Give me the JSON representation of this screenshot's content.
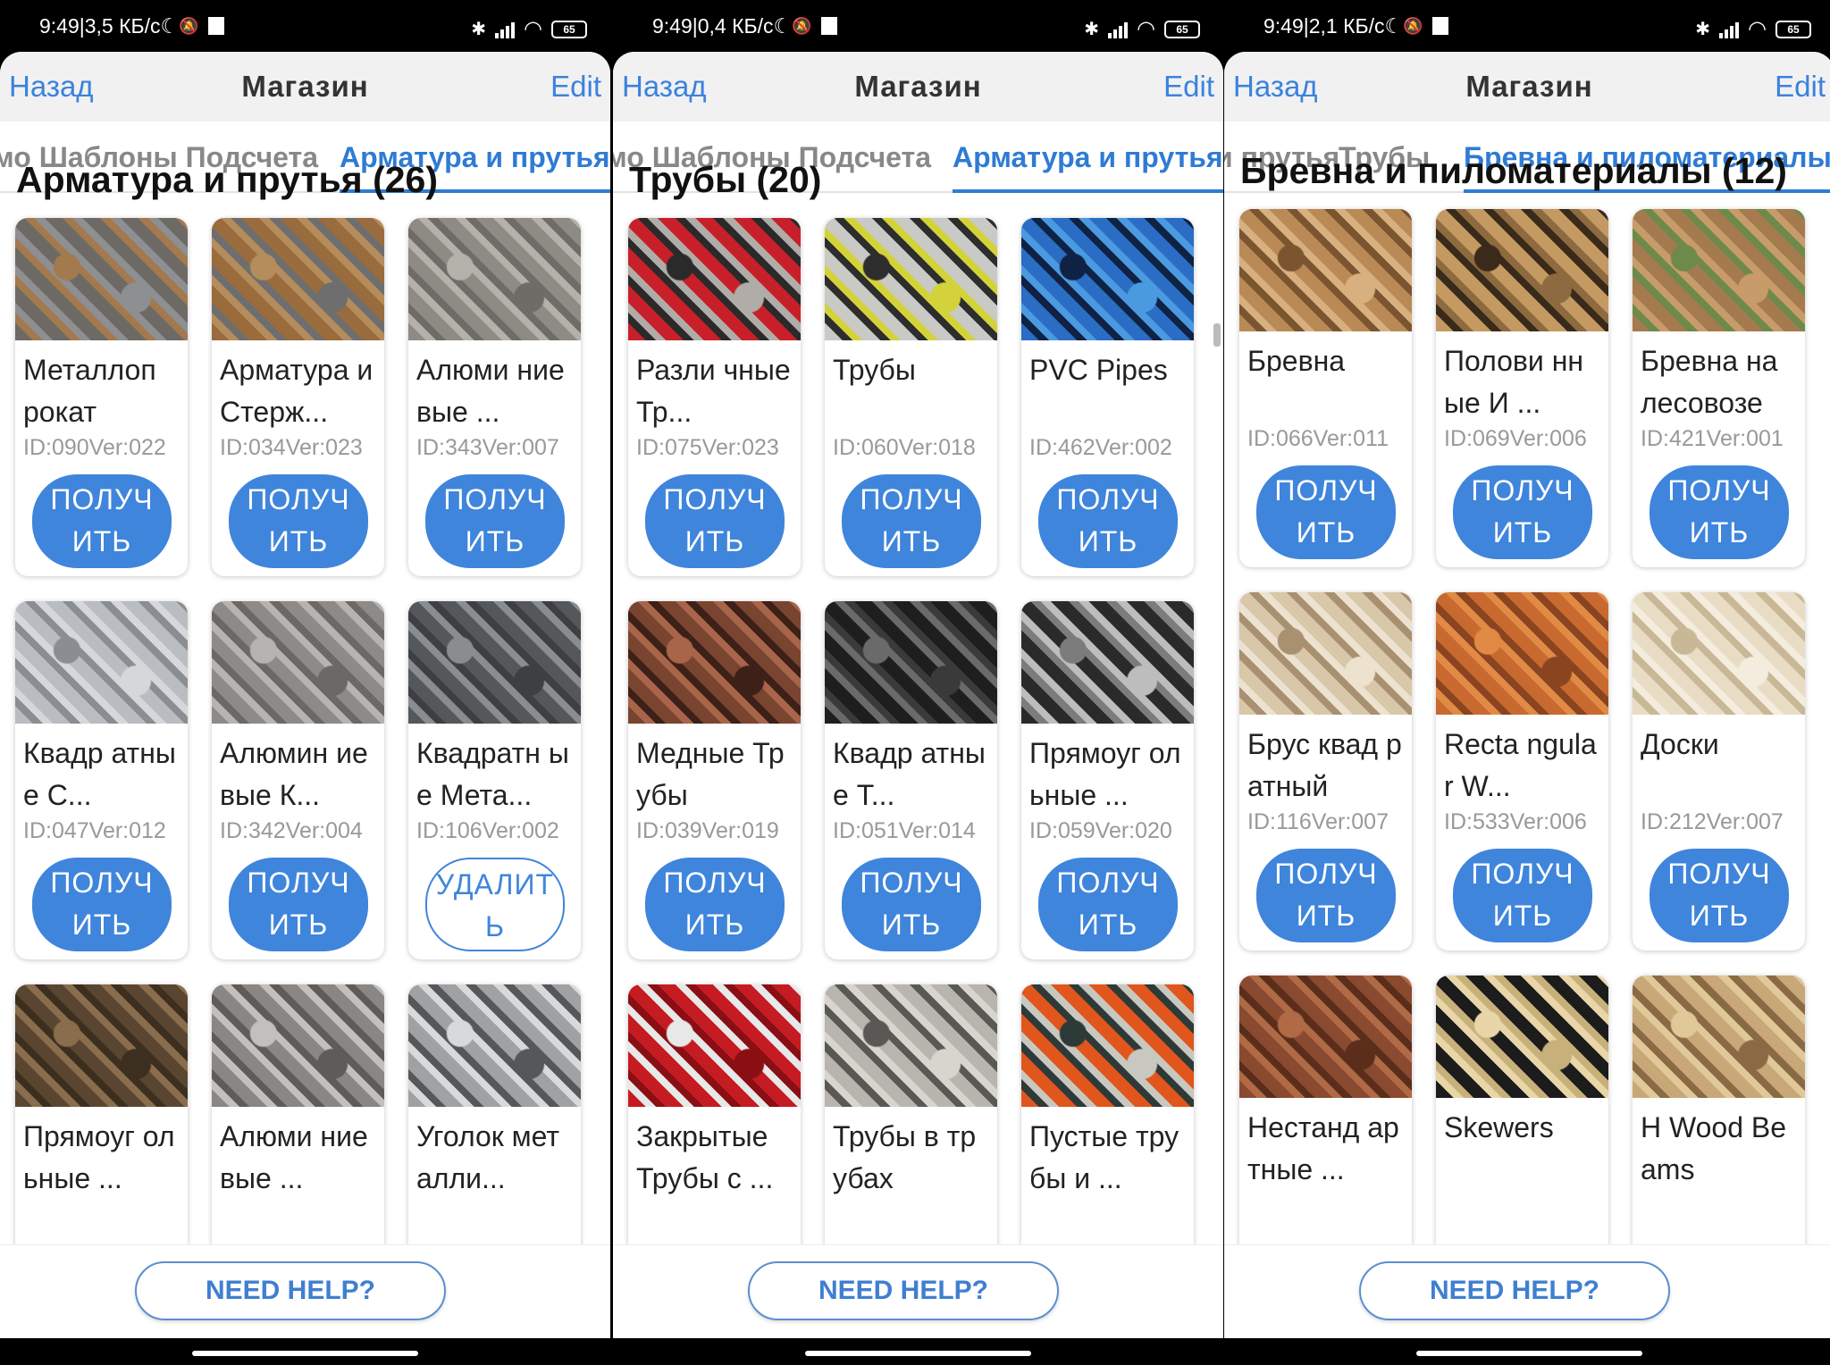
{
  "panels": [
    {
      "status": {
        "time": "9:49",
        "speed": "3,5 КБ/с",
        "battery": "65"
      },
      "nav": {
        "back": "Назад",
        "title": "Магазин",
        "edit": "Edit"
      },
      "tabs": [
        "мо Шаблоны Подсчета",
        "Арматура и прутья"
      ],
      "active_tab": 1,
      "section_title": "Арматура и прутья (26)",
      "cards": [
        {
          "name": "Металлоп рокат",
          "meta": "ID:090Ver:022",
          "button": "ПОЛУЧ ИТЬ",
          "style": "filled",
          "colors": [
            "#6d6a66",
            "#a37a4d",
            "#8d8f92"
          ]
        },
        {
          "name": "Арматура и Стерж...",
          "meta": "ID:034Ver:023",
          "button": "ПОЛУЧ ИТЬ",
          "style": "filled",
          "colors": [
            "#9a6b3d",
            "#b58c5c",
            "#6e6e6e"
          ]
        },
        {
          "name": "Алюми ниевые ...",
          "meta": "ID:343Ver:007",
          "button": "ПОЛУЧ ИТЬ",
          "style": "filled",
          "colors": [
            "#8e8a84",
            "#b4b0aa",
            "#6f6c68"
          ]
        },
        {
          "name": "Квадр атные С...",
          "meta": "ID:047Ver:012",
          "button": "ПОЛУЧ ИТЬ",
          "style": "filled",
          "colors": [
            "#b9bcc0",
            "#8a8d91",
            "#d5d7da"
          ]
        },
        {
          "name": "Алюмин иевые К...",
          "meta": "ID:342Ver:004",
          "button": "ПОЛУЧ ИТЬ",
          "style": "filled",
          "colors": [
            "#8e8a88",
            "#b7b3b1",
            "#6c6866"
          ]
        },
        {
          "name": "Квадратн ые Мета...",
          "meta": "ID:106Ver:002",
          "button": "УДАЛИТ Ь",
          "style": "outline",
          "colors": [
            "#55585b",
            "#8a8d90",
            "#3d3f42"
          ]
        },
        {
          "name": "Прямоуг ольные ...",
          "meta": "",
          "button": "",
          "style": "none",
          "colors": [
            "#5a4630",
            "#8a6d4d",
            "#3d2f20"
          ]
        },
        {
          "name": "Алюми ниевые ...",
          "meta": "",
          "button": "",
          "style": "none",
          "colors": [
            "#8a8683",
            "#c2bfbc",
            "#5e5b58"
          ]
        },
        {
          "name": "Уголок металли...",
          "meta": "",
          "button": "",
          "style": "none",
          "colors": [
            "#9fa1a3",
            "#d8d9da",
            "#55575a"
          ]
        }
      ],
      "help": "NEED HELP?"
    },
    {
      "status": {
        "time": "9:49",
        "speed": "0,4 КБ/с",
        "battery": "65"
      },
      "nav": {
        "back": "Назад",
        "title": "Магазин",
        "edit": "Edit"
      },
      "tabs": [
        "мо Шаблоны Подсчета",
        "Арматура и прутья"
      ],
      "active_tab": 1,
      "section_title": "Трубы (20)",
      "cards": [
        {
          "name": "Разли чные Тр...",
          "meta": "ID:075Ver:023",
          "button": "ПОЛУЧ ИТЬ",
          "style": "filled",
          "colors": [
            "#c8202a",
            "#2a2a2a",
            "#b0aca8"
          ]
        },
        {
          "name": "Трубы",
          "meta": "ID:060Ver:018",
          "button": "ПОЛУЧ ИТЬ",
          "style": "filled",
          "colors": [
            "#c9c9c5",
            "#2d2d2d",
            "#d4d23a"
          ]
        },
        {
          "name": "PVC Pipes",
          "meta": "ID:462Ver:002",
          "button": "ПОЛУЧ ИТЬ",
          "style": "filled",
          "colors": [
            "#2b6cc4",
            "#0f2244",
            "#4a9ae0"
          ]
        },
        {
          "name": "Медные Трубы",
          "meta": "ID:039Ver:019",
          "button": "ПОЛУЧ ИТЬ",
          "style": "filled",
          "colors": [
            "#7a4530",
            "#a8654a",
            "#3d2018"
          ]
        },
        {
          "name": "Квадр атные Т...",
          "meta": "ID:051Ver:014",
          "button": "ПОЛУЧ ИТЬ",
          "style": "filled",
          "colors": [
            "#1e1e1e",
            "#6a6a6a",
            "#3a3a3a"
          ]
        },
        {
          "name": "Прямоуг ольные ...",
          "meta": "ID:059Ver:020",
          "button": "ПОЛУЧ ИТЬ",
          "style": "filled",
          "colors": [
            "#2a2a2a",
            "#7c7c7c",
            "#bdbdbd"
          ]
        },
        {
          "name": "Закрытые Трубы с ...",
          "meta": "",
          "button": "",
          "style": "none",
          "colors": [
            "#c41c22",
            "#e8e8e8",
            "#8a0f14"
          ]
        },
        {
          "name": "Трубы в трубах",
          "meta": "",
          "button": "",
          "style": "none",
          "colors": [
            "#b8b4ae",
            "#5a5854",
            "#d8d4ce"
          ]
        },
        {
          "name": "Пустые трубы и ...",
          "meta": "",
          "button": "",
          "style": "none",
          "colors": [
            "#e0561c",
            "#2d3a38",
            "#c8c8c0"
          ]
        }
      ],
      "help": "NEED HELP?"
    },
    {
      "status": {
        "time": "9:49",
        "speed": "2,1 КБ/с",
        "battery": "65"
      },
      "nav": {
        "back": "Назад",
        "title": "Магазин",
        "edit": "Edit"
      },
      "tabs": [
        "и прутья",
        "Трубы",
        "Бревна и пиломатериалы"
      ],
      "active_tab": 2,
      "section_title": "Бревна и пиломатериалы (12)",
      "cards": [
        {
          "name": "Бревна",
          "meta": "ID:066Ver:011",
          "button": "ПОЛУЧ ИТЬ",
          "style": "filled",
          "colors": [
            "#b98a55",
            "#7a5530",
            "#d8b080"
          ]
        },
        {
          "name": "Полови нные И ...",
          "meta": "ID:069Ver:006",
          "button": "ПОЛУЧ ИТЬ",
          "style": "filled",
          "colors": [
            "#c49a62",
            "#3a2a1a",
            "#8e6a40"
          ]
        },
        {
          "name": "Бревна на лесовозе",
          "meta": "ID:421Ver:001",
          "button": "ПОЛУЧ ИТЬ",
          "style": "filled",
          "colors": [
            "#a57a4e",
            "#6d8a4a",
            "#c79c6a"
          ]
        },
        {
          "name": "Брус квад ратный",
          "meta": "ID:116Ver:007",
          "button": "ПОЛУЧ ИТЬ",
          "style": "filled",
          "colors": [
            "#d8c7a8",
            "#a89070",
            "#ece2cf"
          ]
        },
        {
          "name": "Recta ngular W...",
          "meta": "ID:533Ver:006",
          "button": "ПОЛУЧ ИТЬ",
          "style": "filled",
          "colors": [
            "#c86a30",
            "#e08a45",
            "#8a4420"
          ]
        },
        {
          "name": "Доски",
          "meta": "ID:212Ver:007",
          "button": "ПОЛУЧ ИТЬ",
          "style": "filled",
          "colors": [
            "#e8dcc4",
            "#c8b896",
            "#f4ecdc"
          ]
        },
        {
          "name": "Нестанд артные ...",
          "meta": "",
          "button": "",
          "style": "none",
          "colors": [
            "#8a4a30",
            "#b06a45",
            "#5a2e1a"
          ]
        },
        {
          "name": "Skewers",
          "meta": "",
          "button": "",
          "style": "none",
          "colors": [
            "#1c1c1c",
            "#e8d6a8",
            "#c8b07a"
          ]
        },
        {
          "name": "H Wood Beams",
          "meta": "",
          "button": "",
          "style": "none",
          "colors": [
            "#c8a878",
            "#e0c898",
            "#8a6a44"
          ]
        }
      ],
      "help": "NEED HELP?"
    }
  ],
  "colors": {
    "accent": "#3f85dc",
    "tab_active": "#2f7bd4",
    "nav_bg": "#f1f1f2"
  }
}
